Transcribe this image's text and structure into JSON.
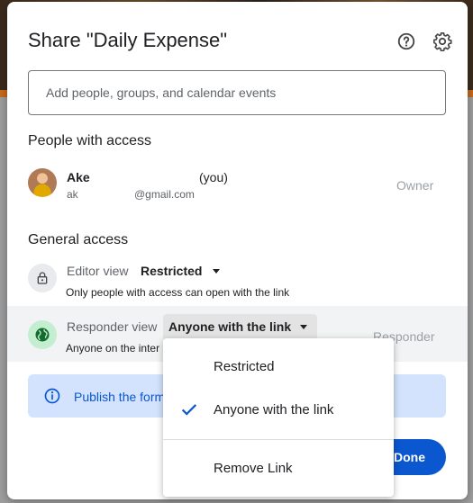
{
  "dialog": {
    "title": "Share \"Daily Expense\"",
    "add_placeholder": "Add people, groups, and calendar events",
    "help_icon": "help-circle-icon",
    "settings_icon": "gear-icon"
  },
  "people": {
    "section_title": "People with access",
    "person": {
      "name": "Ake",
      "you": "(you)",
      "email_start": "ak",
      "email_end": "@gmail.com",
      "role": "Owner"
    }
  },
  "general_access": {
    "section_title": "General access",
    "editor": {
      "label": "Editor view",
      "value": "Restricted",
      "description": "Only people with access can open with the link"
    },
    "responder": {
      "label": "Responder view",
      "value": "Anyone with the link",
      "description": "Anyone on the inter",
      "role": "Responder"
    }
  },
  "info": {
    "text": "Publish the form"
  },
  "menu": {
    "items": [
      {
        "label": "Restricted",
        "selected": false
      },
      {
        "label": "Anyone with the link",
        "selected": true
      },
      {
        "label": "Remove Link",
        "selected": false
      }
    ]
  },
  "buttons": {
    "done": "Done"
  },
  "colors": {
    "accent": "#0b57d0",
    "info_bg": "#d3e3fd",
    "globe_bg": "#c4eed0"
  }
}
